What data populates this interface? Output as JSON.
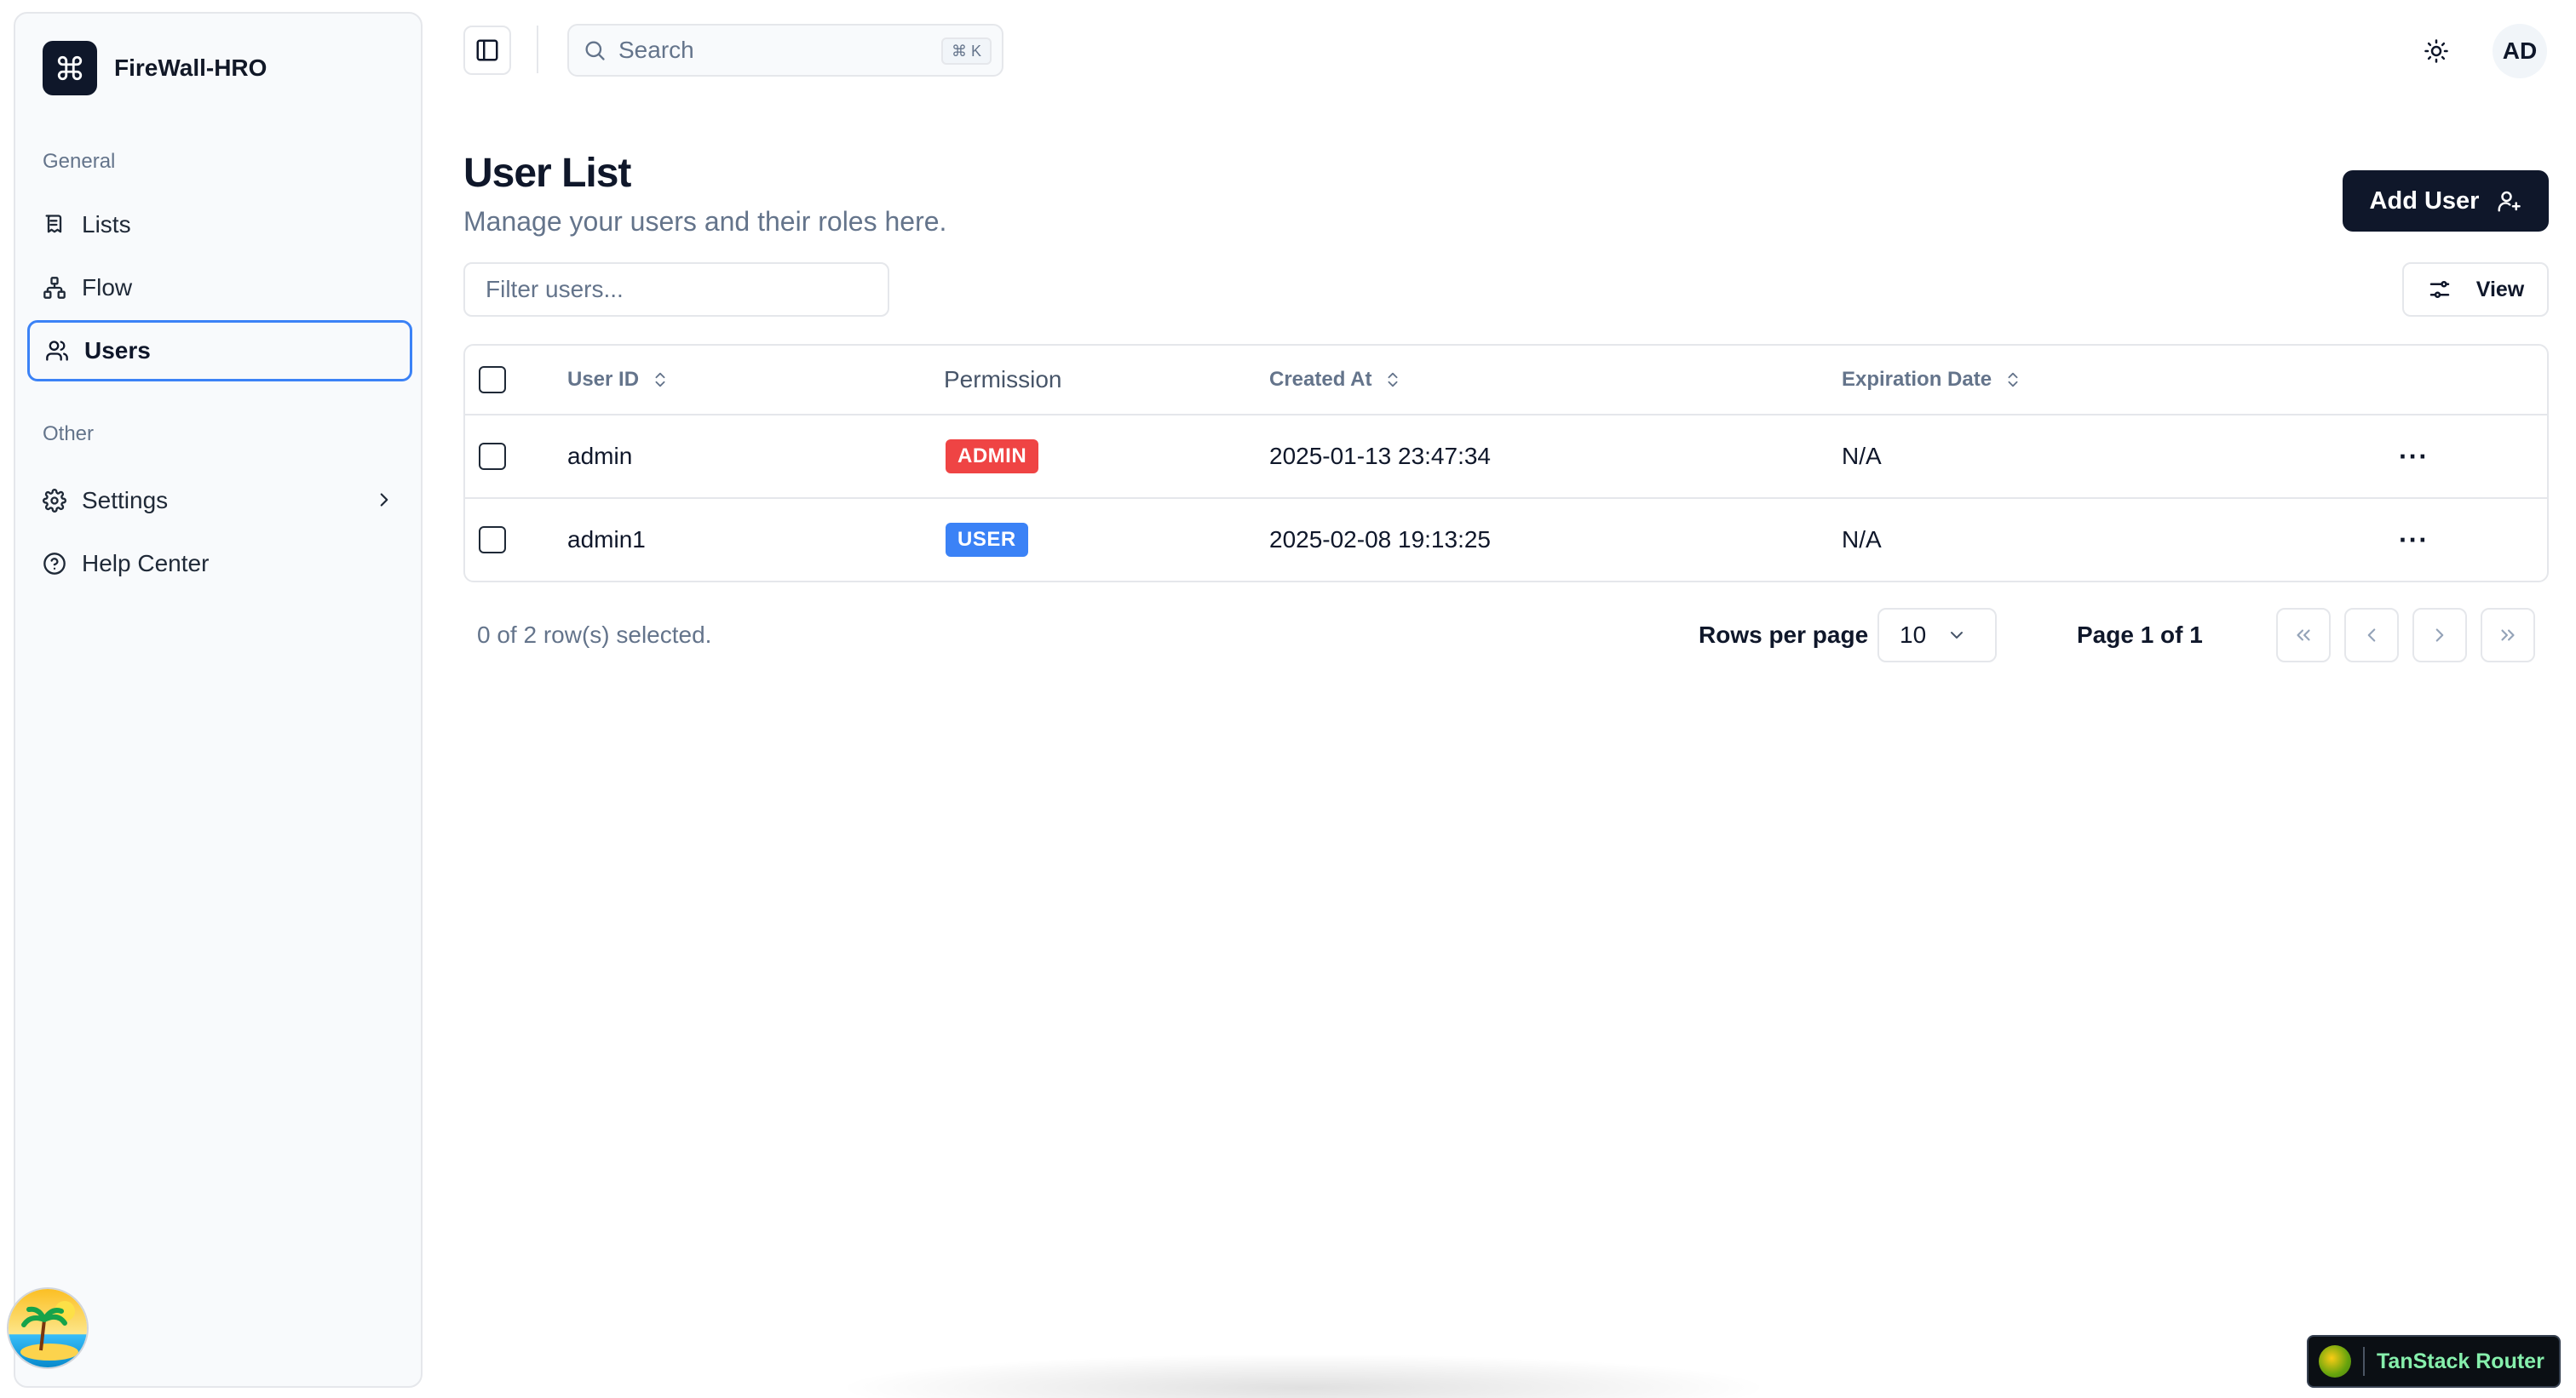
{
  "app": {
    "name": "FireWall-HRO"
  },
  "sidebar": {
    "groups": [
      {
        "label": "General",
        "items": [
          {
            "label": "Lists",
            "icon": "list-icon"
          },
          {
            "label": "Flow",
            "icon": "flow-icon"
          },
          {
            "label": "Users",
            "icon": "users-icon",
            "active": true
          }
        ]
      },
      {
        "label": "Other",
        "items": [
          {
            "label": "Settings",
            "icon": "gear-icon"
          },
          {
            "label": "Help Center",
            "icon": "help-icon"
          }
        ]
      }
    ]
  },
  "topbar": {
    "search_label": "Search",
    "search_shortcut": "⌘ K",
    "user_initials": "AD"
  },
  "page": {
    "title": "User List",
    "subtitle": "Manage your users and their roles here.",
    "add_button": "Add User",
    "filter_placeholder": "Filter users...",
    "view_button": "View"
  },
  "table": {
    "columns": [
      "User ID",
      "Permission",
      "Created At",
      "Expiration Date"
    ],
    "rows": [
      {
        "user_id": "admin",
        "permission": "ADMIN",
        "created_at": "2025-01-13 23:47:34",
        "expiration": "N/A"
      },
      {
        "user_id": "admin1",
        "permission": "USER",
        "created_at": "2025-02-08 19:13:25",
        "expiration": "N/A"
      }
    ],
    "actions_label": "···"
  },
  "pagination": {
    "selected_text": "0 of 2 row(s) selected.",
    "rows_per_page_label": "Rows per page",
    "rows_per_page_value": "10",
    "page_info": "Page 1 of 1"
  },
  "devtools": {
    "label": "TanStack Router"
  },
  "colors": {
    "primary": "#0f172a",
    "accent": "#3b82f6",
    "admin_badge": "#ef4444",
    "user_badge": "#3b82f6",
    "muted": "#64748b"
  }
}
